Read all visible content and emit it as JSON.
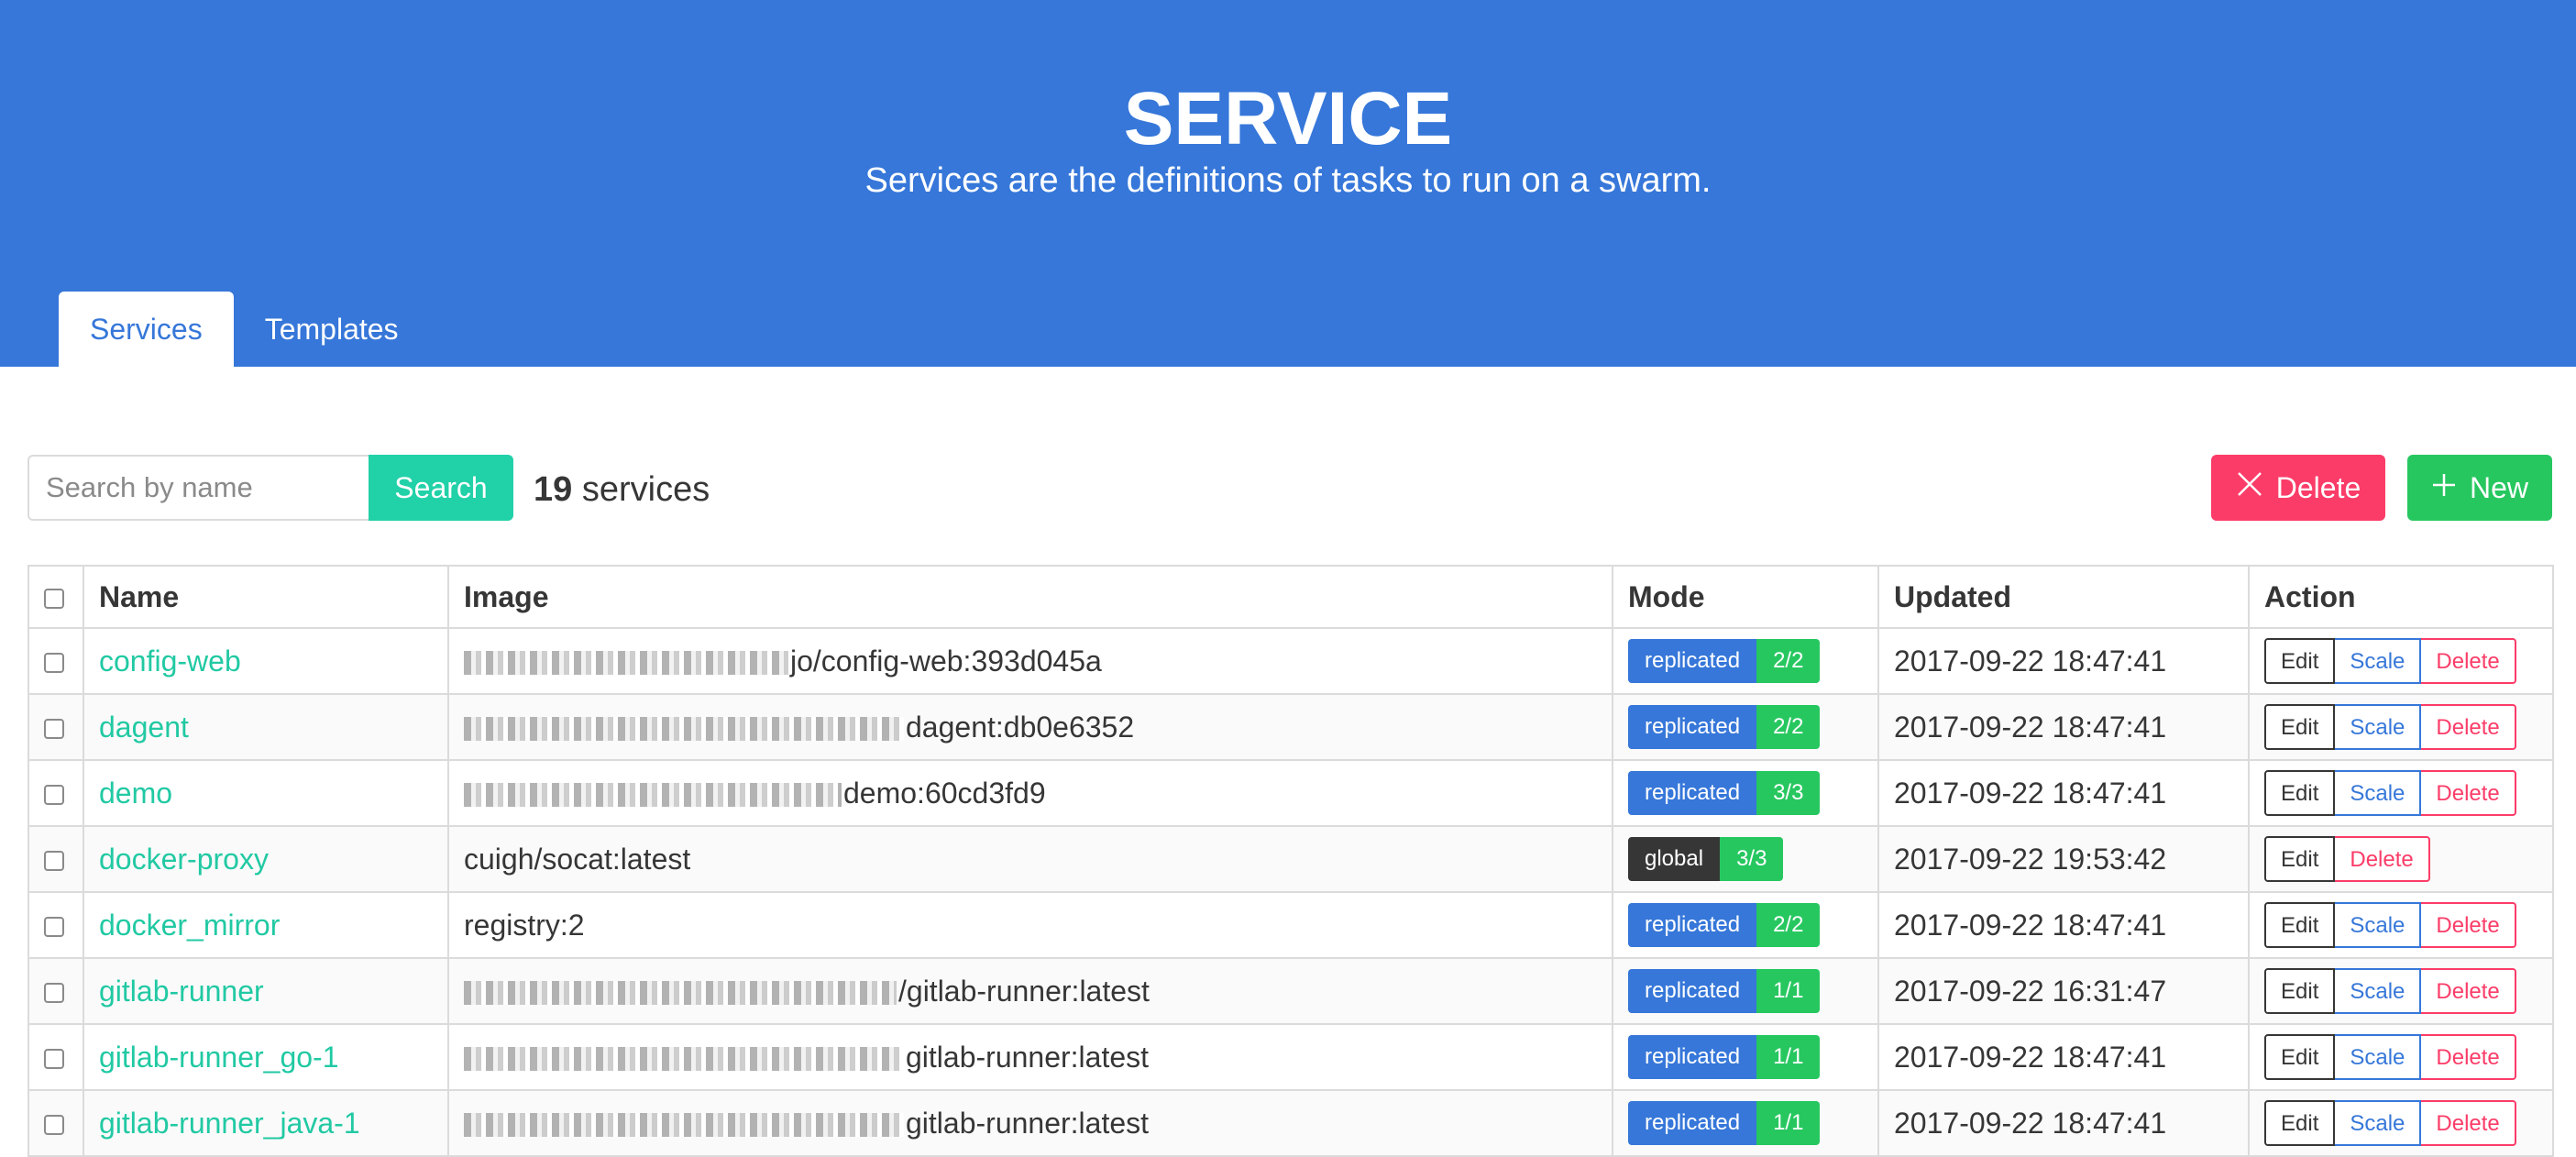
{
  "header": {
    "title": "SERVICE",
    "subtitle": "Services are the definitions of tasks to run on a swarm."
  },
  "tabs": [
    {
      "label": "Services",
      "active": true
    },
    {
      "label": "Templates",
      "active": false
    }
  ],
  "toolbar": {
    "search_placeholder": "Search by name",
    "search_label": "Search",
    "count": "19",
    "count_suffix": "services",
    "delete_label": "Delete",
    "new_label": "New"
  },
  "table": {
    "columns": [
      "Name",
      "Image",
      "Mode",
      "Updated",
      "Action"
    ],
    "rows": [
      {
        "name": "config-web",
        "image": "jo/config-web:393d045a",
        "mode": "replicated",
        "replicas": "2/2",
        "updated": "2017-09-22 18:47:41",
        "actions": [
          "Edit",
          "Scale",
          "Delete"
        ]
      },
      {
        "name": "dagent",
        "image": "dagent:db0e6352",
        "mode": "replicated",
        "replicas": "2/2",
        "updated": "2017-09-22 18:47:41",
        "actions": [
          "Edit",
          "Scale",
          "Delete"
        ]
      },
      {
        "name": "demo",
        "image": "demo:60cd3fd9",
        "mode": "replicated",
        "replicas": "3/3",
        "updated": "2017-09-22 18:47:41",
        "actions": [
          "Edit",
          "Scale",
          "Delete"
        ]
      },
      {
        "name": "docker-proxy",
        "image": "cuigh/socat:latest",
        "mode": "global",
        "replicas": "3/3",
        "updated": "2017-09-22 19:53:42",
        "actions": [
          "Edit",
          "Delete"
        ]
      },
      {
        "name": "docker_mirror",
        "image": "registry:2",
        "mode": "replicated",
        "replicas": "2/2",
        "updated": "2017-09-22 18:47:41",
        "actions": [
          "Edit",
          "Scale",
          "Delete"
        ]
      },
      {
        "name": "gitlab-runner",
        "image": "/gitlab-runner:latest",
        "mode": "replicated",
        "replicas": "1/1",
        "updated": "2017-09-22 16:31:47",
        "actions": [
          "Edit",
          "Scale",
          "Delete"
        ]
      },
      {
        "name": "gitlab-runner_go-1",
        "image": "gitlab-runner:latest",
        "mode": "replicated",
        "replicas": "1/1",
        "updated": "2017-09-22 18:47:41",
        "actions": [
          "Edit",
          "Scale",
          "Delete"
        ]
      },
      {
        "name": "gitlab-runner_java-1",
        "image": "gitlab-runner:latest",
        "mode": "replicated",
        "replicas": "1/1",
        "updated": "2017-09-22 18:47:41",
        "actions": [
          "Edit",
          "Scale",
          "Delete"
        ]
      }
    ]
  },
  "colors": {
    "primary": "#3677d9",
    "accent": "#21d1a8",
    "danger": "#fb3c68",
    "success": "#27c760",
    "dark": "#363636"
  }
}
